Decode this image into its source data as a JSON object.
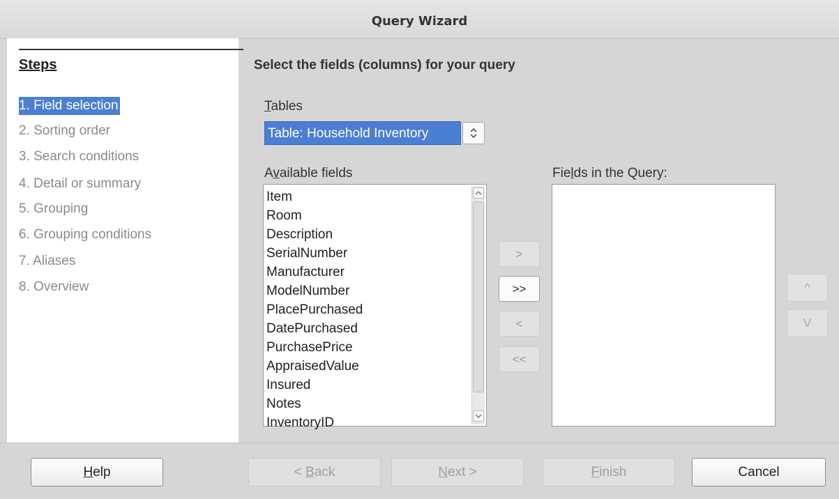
{
  "window": {
    "title": "Query Wizard"
  },
  "steps": {
    "heading": "Steps",
    "items": [
      {
        "label": "1. Field selection",
        "active": true
      },
      {
        "label": "2. Sorting order"
      },
      {
        "label": "3. Search conditions"
      },
      {
        "label": "4. Detail or summary"
      },
      {
        "label": "5. Grouping"
      },
      {
        "label": "6. Grouping conditions"
      },
      {
        "label": "7. Aliases"
      },
      {
        "label": "8. Overview"
      }
    ]
  },
  "main": {
    "heading": "Select the fields (columns) for your query",
    "tables": {
      "label_mnemonic": "T",
      "label_rest": "ables",
      "selected": "Table: Household Inventory"
    },
    "available": {
      "label_pre": "A",
      "label_mnemonic": "v",
      "label_rest": "ailable fields",
      "items": [
        "Item",
        "Room",
        "Description",
        "SerialNumber",
        "Manufacturer",
        "ModelNumber",
        "PlacePurchased",
        "DatePurchased",
        "PurchasePrice",
        "AppraisedValue",
        "Insured",
        "Notes",
        "InventoryID"
      ]
    },
    "query": {
      "label_pre": "Fie",
      "label_mnemonic": "l",
      "label_rest": "ds in the Query:"
    },
    "move_buttons": {
      "add_one": ">",
      "add_all": ">>",
      "remove_one": "<",
      "remove_all": "<<"
    },
    "order_buttons": {
      "up": "^",
      "down": "V"
    }
  },
  "footer": {
    "help": {
      "mnemonic": "H",
      "rest": "elp"
    },
    "back": {
      "pre": "< ",
      "mnemonic": "B",
      "rest": "ack"
    },
    "next": {
      "mnemonic": "N",
      "rest": "ext >"
    },
    "finish": {
      "mnemonic": "F",
      "rest": "inish"
    },
    "cancel": "Cancel"
  }
}
